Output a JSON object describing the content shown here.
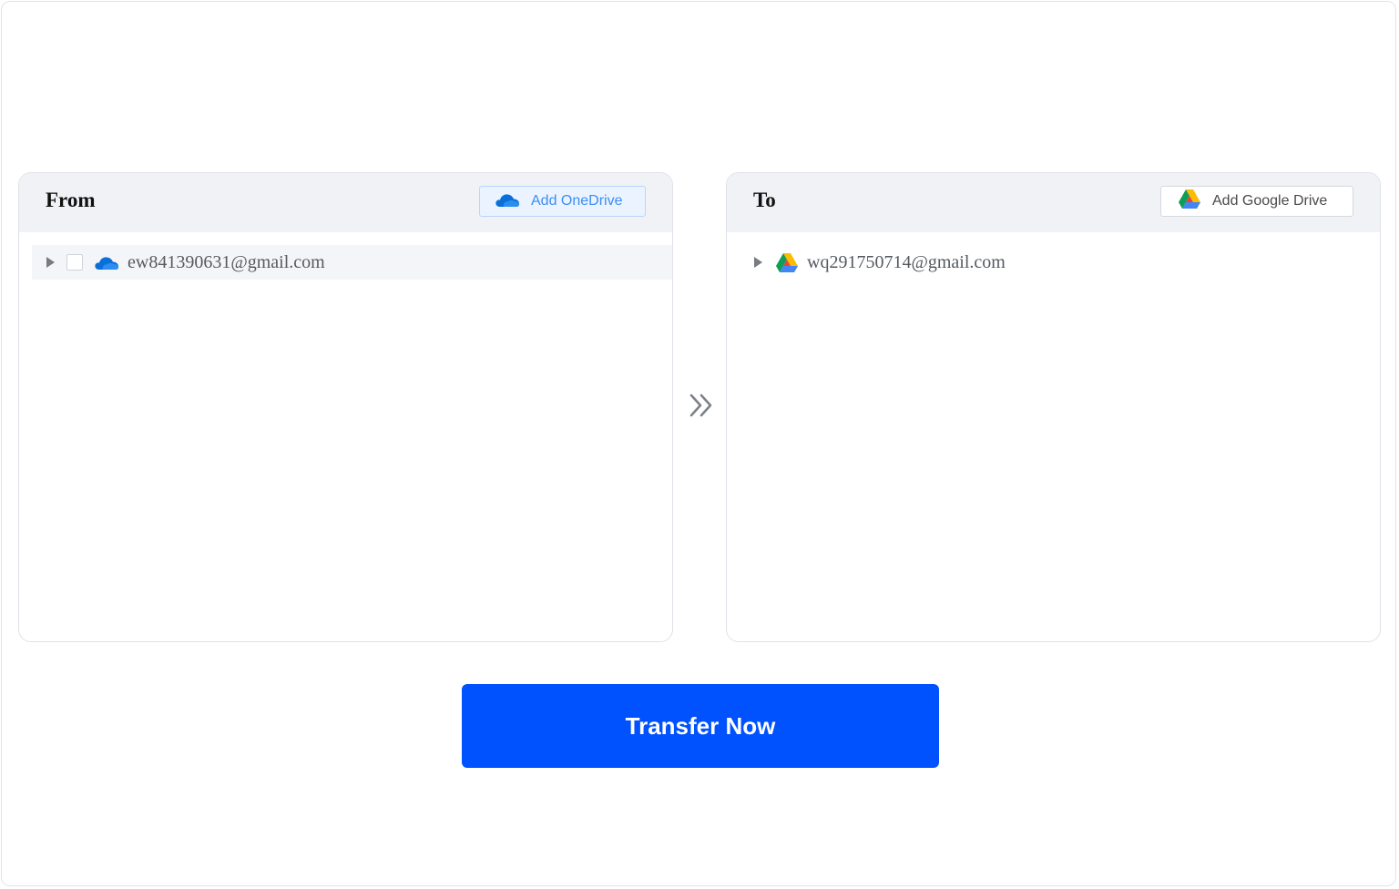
{
  "from_panel": {
    "title": "From",
    "add_button_label": "Add OneDrive",
    "add_button_icon": "onedrive-icon",
    "account": "ew841390631@gmail.com",
    "account_icon": "onedrive-icon",
    "checked": false
  },
  "to_panel": {
    "title": "To",
    "add_button_label": "Add Google Drive",
    "add_button_icon": "google-drive-icon",
    "account": "wq291750714@gmail.com",
    "account_icon": "google-drive-icon"
  },
  "separator_icon": "double-chevron-right-icon",
  "transfer_button_label": "Transfer Now",
  "colors": {
    "primary": "#0052ff",
    "onedrive_blue": "#3b8ff3",
    "panel_header_bg": "#f0f2f5"
  }
}
